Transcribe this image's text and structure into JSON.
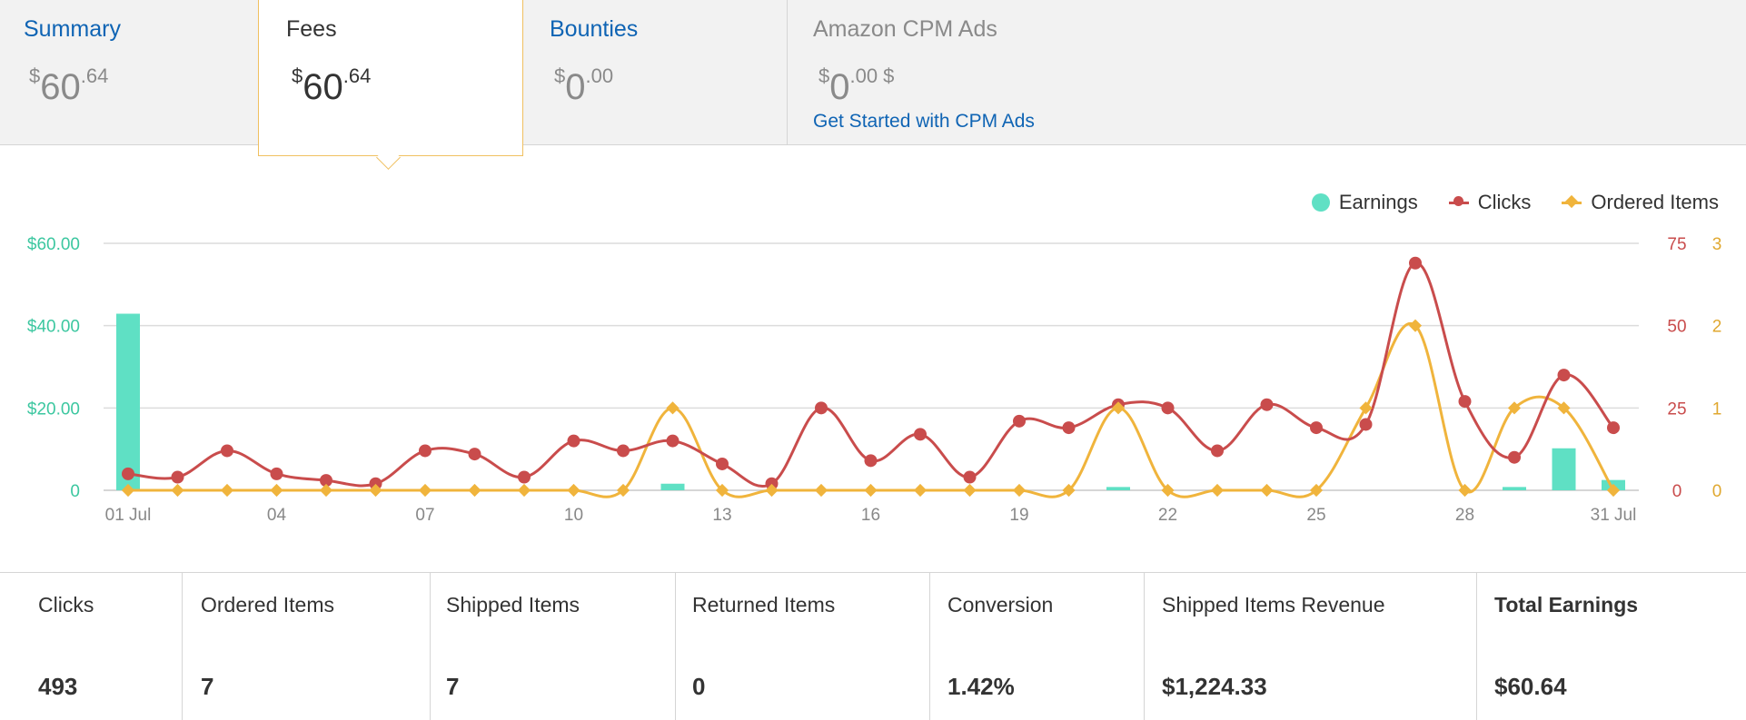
{
  "tabs": {
    "summary": {
      "title": "Summary",
      "currency": "$",
      "whole": "60",
      "cents": ".64"
    },
    "fees": {
      "title": "Fees",
      "currency": "$",
      "whole": "60",
      "cents": ".64"
    },
    "bounties": {
      "title": "Bounties",
      "currency": "$",
      "whole": "0",
      "cents": ".00"
    },
    "cpm": {
      "title": "Amazon CPM Ads",
      "currency": "$",
      "whole": "0",
      "cents": ".00",
      "suffix": "$",
      "link": "Get Started with CPM Ads"
    }
  },
  "chart_data": {
    "type": "bar",
    "legend": {
      "placement": "top-right",
      "items": [
        "Earnings",
        "Clicks",
        "Ordered Items"
      ]
    },
    "x": [
      1,
      2,
      3,
      4,
      5,
      6,
      7,
      8,
      9,
      10,
      11,
      12,
      13,
      14,
      15,
      16,
      17,
      18,
      19,
      20,
      21,
      22,
      23,
      24,
      25,
      26,
      27,
      28,
      29,
      30,
      31
    ],
    "x_tick_labels": [
      {
        "day": 1,
        "label": "01 Jul"
      },
      {
        "day": 4,
        "label": "04"
      },
      {
        "day": 7,
        "label": "07"
      },
      {
        "day": 10,
        "label": "10"
      },
      {
        "day": 13,
        "label": "13"
      },
      {
        "day": 16,
        "label": "16"
      },
      {
        "day": 19,
        "label": "19"
      },
      {
        "day": 22,
        "label": "22"
      },
      {
        "day": 25,
        "label": "25"
      },
      {
        "day": 28,
        "label": "28"
      },
      {
        "day": 31,
        "label": "31 Jul"
      }
    ],
    "grid": true,
    "series": [
      {
        "name": "Earnings",
        "type": "bar",
        "axis": "left",
        "color": "#5fe0c4",
        "values": [
          42.9,
          0,
          0,
          0,
          0,
          0,
          0,
          0,
          0,
          0,
          0,
          1.6,
          0,
          0,
          0,
          0,
          0,
          0,
          0,
          0,
          0.8,
          0,
          0,
          0,
          0,
          0,
          0,
          0,
          0.8,
          10.2,
          2.5
        ]
      },
      {
        "name": "Clicks",
        "type": "line",
        "axis": "right1",
        "color": "#c94c4c",
        "values": [
          5,
          4,
          12,
          5,
          3,
          2,
          12,
          11,
          4,
          15,
          12,
          15,
          8,
          2,
          25,
          9,
          17,
          4,
          21,
          19,
          26,
          25,
          12,
          26,
          19,
          20,
          69,
          27,
          10,
          35,
          19
        ]
      },
      {
        "name": "Ordered Items",
        "type": "line",
        "axis": "right2",
        "color": "#f0b43c",
        "values": [
          0,
          0,
          0,
          0,
          0,
          0,
          0,
          0,
          0,
          0,
          0,
          1,
          0,
          0,
          0,
          0,
          0,
          0,
          0,
          0,
          1,
          0,
          0,
          0,
          0,
          1,
          2,
          0,
          1,
          1,
          0
        ]
      }
    ],
    "axes": {
      "left": {
        "ylim": [
          0,
          60
        ],
        "ticks": [
          0,
          20,
          40,
          60
        ],
        "tick_labels": [
          "0",
          "$20.00",
          "$40.00",
          "$60.00"
        ],
        "color": "#3cc7a0"
      },
      "right1": {
        "ylim": [
          0,
          75
        ],
        "ticks": [
          0,
          25,
          50,
          75
        ],
        "tick_labels": [
          "0",
          "25",
          "50",
          "75"
        ],
        "color": "#c94c4c"
      },
      "right2": {
        "ylim": [
          0,
          3
        ],
        "ticks": [
          0,
          1,
          2,
          3
        ],
        "tick_labels": [
          "0",
          "1",
          "2",
          "3"
        ],
        "color": "#e0a830"
      }
    }
  },
  "metrics": [
    {
      "label": "Clicks",
      "value": "493",
      "bold_label": false
    },
    {
      "label": "Ordered Items",
      "value": "7",
      "bold_label": false
    },
    {
      "label": "Shipped Items",
      "value": "7",
      "bold_label": false
    },
    {
      "label": "Returned Items",
      "value": "0",
      "bold_label": false
    },
    {
      "label": "Conversion",
      "value": "1.42%",
      "bold_label": false
    },
    {
      "label": "Shipped Items Revenue",
      "value": "$1,224.33",
      "bold_label": false
    },
    {
      "label": "Total Earnings",
      "value": "$60.64",
      "bold_label": true
    }
  ]
}
